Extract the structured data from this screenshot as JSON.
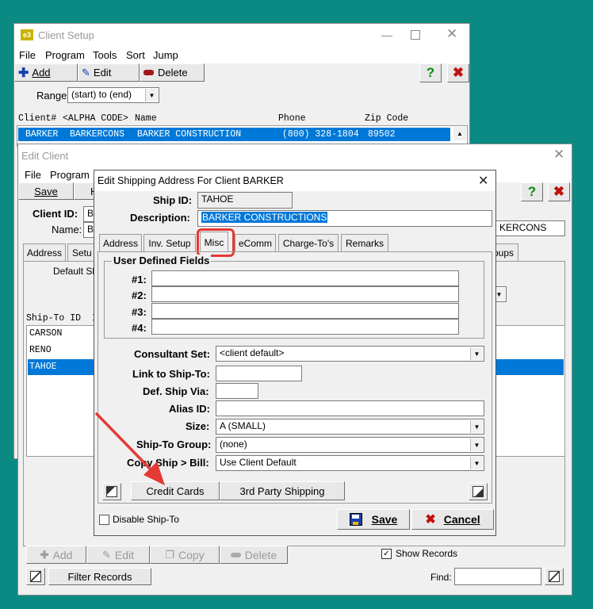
{
  "client_setup": {
    "title": "Client Setup",
    "menu": [
      "File",
      "Program",
      "Tools",
      "Sort",
      "Jump"
    ],
    "toolbar": {
      "add": "Add",
      "edit": "Edit",
      "delete": "Delete"
    },
    "range_label": "Range:",
    "range_value": "(start) to (end)",
    "columns": {
      "client": "Client#",
      "alpha": "<ALPHA CODE>",
      "name": "Name",
      "phone": "Phone",
      "zip": "Zip Code"
    },
    "row": {
      "client": "BARKER",
      "alpha": "BARKERCONS",
      "name": "BARKER CONSTRUCTION",
      "phone": "(800) 328-1804",
      "zip": "89502"
    }
  },
  "edit_client": {
    "title": "Edit Client",
    "menu": [
      "File",
      "Program"
    ],
    "save_label": "Save",
    "h_stub": "H",
    "client_id_label": "Client ID:",
    "client_id_value": "BA",
    "name_label": "Name:",
    "name_value": "BA",
    "alpha_value": "KERCONS",
    "tabs": [
      "Address",
      "Setu"
    ],
    "tab_right": "oups",
    "default_ship_label": "Default Sh",
    "shipto_header": "Ship-To ID",
    "shipto_header_stub": "I",
    "shipto_list": [
      "CARSON",
      "RENO",
      "TAHOE"
    ],
    "bottom": {
      "add": "Add",
      "edit": "Edit",
      "copy": "Copy",
      "delete": "Delete",
      "show_records": "Show Records",
      "filter": "Filter Records",
      "find": "Find:"
    }
  },
  "ship_dialog": {
    "title": "Edit Shipping Address For Client BARKER",
    "ship_id_label": "Ship ID:",
    "ship_id_value": "TAHOE",
    "description_label": "Description:",
    "description_value": "BARKER CONSTRUCTIONS",
    "tabs": [
      "Address",
      "Inv. Setup",
      "Misc",
      "eComm",
      "Charge-To's",
      "Remarks"
    ],
    "user_defined_title": "User Defined Fields",
    "udf_labels": [
      "#1:",
      "#2:",
      "#3:",
      "#4:"
    ],
    "consultant_label": "Consultant Set:",
    "consultant_value": "<client default>",
    "link_label": "Link to Ship-To:",
    "ship_via_label": "Def. Ship Via:",
    "alias_label": "Alias ID:",
    "size_label": "Size:",
    "size_value": "A (SMALL)",
    "group_label": "Ship-To Group:",
    "group_value": "(none)",
    "copy_label": "Copy Ship > Bill:",
    "copy_value": "Use Client Default",
    "credit_cards": "Credit Cards",
    "third_party": "3rd Party Shipping",
    "disable_label": "Disable Ship-To",
    "save": "Save",
    "cancel": "Cancel"
  },
  "colors": {
    "teal": "#0a8a82",
    "selection": "#0078d7",
    "annotation": "#e53935"
  }
}
